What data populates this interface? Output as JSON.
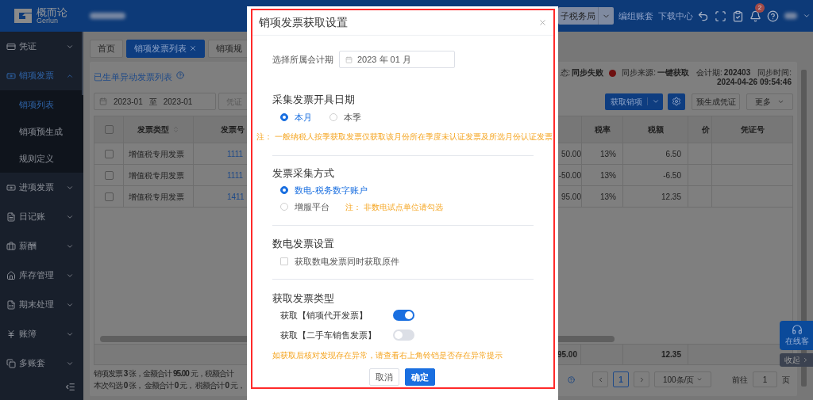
{
  "header": {
    "logo": {
      "name": "概而论",
      "subname": "Gerlun"
    },
    "bureau": "子税务局",
    "links": [
      "编组账套",
      "下载中心"
    ],
    "notification_count": "2"
  },
  "sidebar": {
    "items": [
      {
        "label": "凭证",
        "expanded": false
      },
      {
        "label": "销项发票",
        "expanded": true,
        "children": [
          {
            "label": "销项列表",
            "selected": true
          },
          {
            "label": "销项预生成",
            "selected": false
          },
          {
            "label": "规则定义",
            "selected": false
          }
        ]
      },
      {
        "label": "进项发票",
        "expanded": false
      },
      {
        "label": "日记账",
        "expanded": false
      },
      {
        "label": "薪酬",
        "expanded": false
      },
      {
        "label": "库存管理",
        "expanded": false
      },
      {
        "label": "期末处理",
        "expanded": false
      },
      {
        "label": "账簿",
        "expanded": false
      },
      {
        "label": "多账套",
        "expanded": false
      }
    ]
  },
  "tabs": [
    {
      "label": "首页",
      "selected": false
    },
    {
      "label": "销项发票列表",
      "selected": true
    },
    {
      "label": "销项规",
      "selected": false
    }
  ],
  "list": {
    "title": "已生单异动发票列表",
    "sync": {
      "status_label": "态:",
      "status": "同步失败",
      "source_label": "同步来源:",
      "source": "一键获取",
      "period_label": "会计期:",
      "period": "202403",
      "time_label": "同步时间:",
      "time": "2024-04-26 09:54:46"
    },
    "filters": {
      "date_from": "2023-01",
      "date_sep": "至",
      "date_to": "2023-01",
      "status_placeholder": "凭证"
    },
    "buttons": {
      "fetch": "获取销项",
      "pregenerate": "预生成凭证",
      "more": "更多"
    },
    "table": {
      "select_all": false,
      "left_columns": [
        "发票类型",
        "发票号"
      ],
      "right_columns": [
        "税率",
        "税额",
        "价",
        "凭证号"
      ],
      "rows": [
        {
          "checked": false,
          "type": "增值税专用发票",
          "number": "1111",
          "amount": "50.00",
          "rate": "13%",
          "tax": "6.50"
        },
        {
          "checked": false,
          "type": "增值税专用发票",
          "number": "1111",
          "amount": "-50.00",
          "rate": "13%",
          "tax": "-6.50"
        },
        {
          "checked": false,
          "type": "增值税专用发票",
          "number": "1411",
          "amount": "95.00",
          "rate": "13%",
          "tax": "12.35"
        }
      ],
      "summary": {
        "amount": "95.00",
        "tax": "12.35"
      }
    },
    "footer": [
      "销项发票 **3** 张，金额合计 **95.00** 元，税额合计",
      "本次勾选 **0** 张， 金额合计 **0** 元， 税额合计 **0** 元，"
    ],
    "pagination": {
      "page": "1",
      "page_size": "100条/页",
      "goto_label": "前往",
      "goto_value": "1",
      "page_unit": "页"
    }
  },
  "float": {
    "support": "在线客",
    "collapse": "收起"
  },
  "modal": {
    "title": "销项发票获取设置",
    "period": {
      "label": "选择所属会计期",
      "value": "2023 年 01 月"
    },
    "sections": [
      {
        "kind": "radio-inline",
        "title": "采集发票开具日期",
        "options": [
          {
            "label": "本月",
            "selected": true
          },
          {
            "label": "本季",
            "selected": false
          }
        ],
        "note": {
          "label": "注：",
          "text": "一般纳税人按季获取发票仅获取该月份所在季度未认证发票及所选月份认证发票"
        }
      },
      {
        "kind": "radio-list",
        "title": "发票采集方式",
        "options": [
          {
            "label": "数电-税务数字账户",
            "selected": true
          },
          {
            "label": "增服平台",
            "selected": false,
            "note": {
              "label": "注：",
              "text": "非数电试点单位请勾选"
            }
          }
        ]
      },
      {
        "kind": "checkbox",
        "title": "数电发票设置",
        "options": [
          {
            "label": "获取数电发票同时获取原件",
            "checked": false
          }
        ]
      },
      {
        "kind": "switch",
        "title": "获取发票类型",
        "options": [
          {
            "label": "获取【销项代开发票】",
            "on": true
          },
          {
            "label": "获取【二手车销售发票】",
            "on": false
          }
        ]
      }
    ],
    "warning": "如获取后核对发现存在异常，请查看右上角铃铛是否存在异常提示",
    "buttons": [
      {
        "label": "取消",
        "kind": "default"
      },
      {
        "label": "确定",
        "kind": "primary"
      }
    ]
  }
}
